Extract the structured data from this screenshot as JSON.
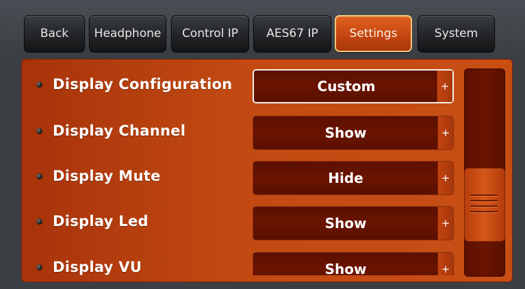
{
  "tabs": [
    {
      "label": "Back",
      "active": false
    },
    {
      "label": "Headphone",
      "active": false
    },
    {
      "label": "Control IP",
      "active": false
    },
    {
      "label": "AES67 IP",
      "active": false
    },
    {
      "label": "Settings",
      "active": true
    },
    {
      "label": "System",
      "active": false
    }
  ],
  "settings": [
    {
      "label": "Display Configuration",
      "value": "Custom",
      "selected": true
    },
    {
      "label": "Display Channel",
      "value": "Show",
      "selected": false
    },
    {
      "label": "Display Mute",
      "value": "Hide",
      "selected": false
    },
    {
      "label": "Display Led",
      "value": "Show",
      "selected": false
    },
    {
      "label": "Display VU",
      "value": "Show",
      "selected": false
    }
  ],
  "plus_glyph": "+",
  "colors": {
    "accent": "#c84e14",
    "field_bg": "#5c1000",
    "active_tab_border": "#f0c77a"
  }
}
